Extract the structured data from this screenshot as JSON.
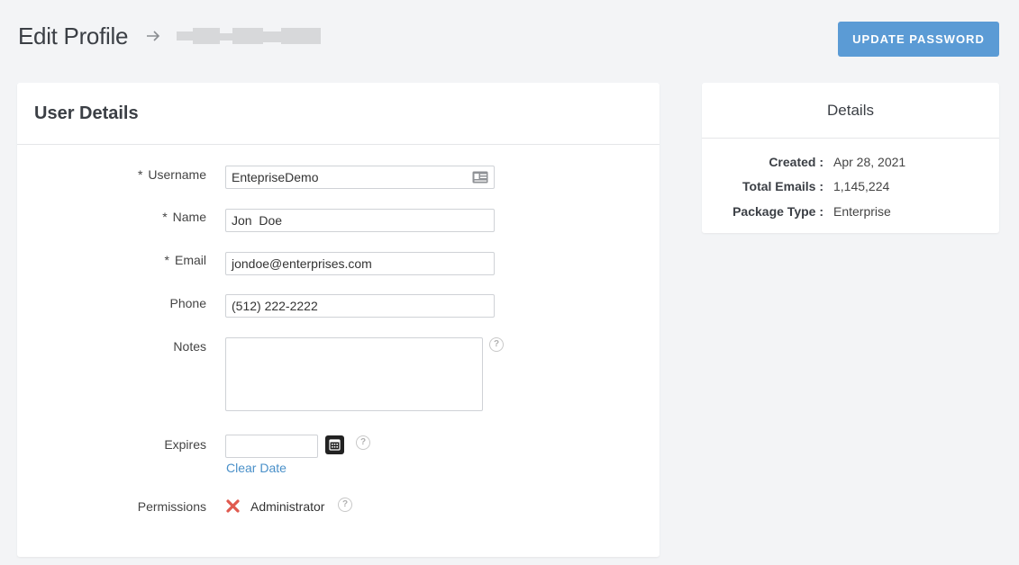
{
  "header": {
    "title": "Edit Profile",
    "update_password_label": "UPDATE PASSWORD"
  },
  "user_details": {
    "title": "User Details",
    "username": {
      "label": "Username",
      "required_mark": "*",
      "value": "EntepriseDemo"
    },
    "name": {
      "label": "Name",
      "required_mark": "*",
      "value": "Jon  Doe"
    },
    "email": {
      "label": "Email",
      "required_mark": "*",
      "value": "jondoe@enterprises.com"
    },
    "phone": {
      "label": "Phone",
      "value": "(512) 222-2222"
    },
    "notes": {
      "label": "Notes",
      "value": ""
    },
    "expires": {
      "label": "Expires",
      "value": "",
      "clear_label": "Clear Date"
    },
    "permissions": {
      "label": "Permissions",
      "item": "Administrator",
      "enabled": false
    }
  },
  "details": {
    "title": "Details",
    "rows": [
      {
        "label": "Created :",
        "value": "Apr 28, 2021"
      },
      {
        "label": "Total Emails :",
        "value": "1,145,224"
      },
      {
        "label": "Package Type :",
        "value": "Enterprise"
      }
    ]
  },
  "icons": {
    "help": "?",
    "breadcrumb_arrow": "arrow-right-icon",
    "id_card": "id-card-icon",
    "calendar": "calendar-icon",
    "denied": "x-icon"
  },
  "colors": {
    "primary_button": "#5b9bd5",
    "link": "#4a90c9",
    "denied": "#e05a4f",
    "background": "#f3f4f6"
  }
}
